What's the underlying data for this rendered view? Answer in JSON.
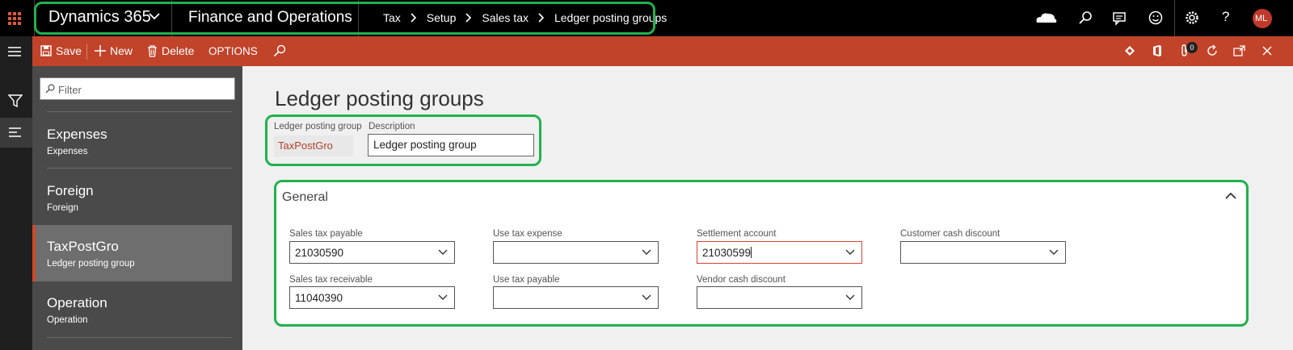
{
  "topbar": {
    "brand": "Dynamics 365",
    "app_name": "Finance and Operations",
    "breadcrumb": [
      "Tax",
      "Setup",
      "Sales tax",
      "Ledger posting groups"
    ],
    "avatar_initials": "ML"
  },
  "actions": {
    "save": "Save",
    "new": "New",
    "delete": "Delete",
    "options": "OPTIONS",
    "notification_count": "0"
  },
  "list": {
    "filter_placeholder": "Filter",
    "items": [
      {
        "title": "Expenses",
        "sub": "Expenses"
      },
      {
        "title": "Foreign",
        "sub": "Foreign"
      },
      {
        "title": "TaxPostGro",
        "sub": "Ledger posting group"
      },
      {
        "title": "Operation",
        "sub": "Operation"
      }
    ],
    "selected_index": 2
  },
  "page": {
    "title": "Ledger posting groups",
    "header_fields": {
      "group_label": "Ledger posting group",
      "group_value": "TaxPostGro",
      "description_label": "Description",
      "description_value": "Ledger posting group"
    }
  },
  "general": {
    "title": "General",
    "fields": {
      "sales_tax_payable": {
        "label": "Sales tax payable",
        "value": "21030590"
      },
      "sales_tax_receivable": {
        "label": "Sales tax receivable",
        "value": "11040390"
      },
      "use_tax_expense": {
        "label": "Use tax expense",
        "value": ""
      },
      "use_tax_payable": {
        "label": "Use tax payable",
        "value": ""
      },
      "settlement_account": {
        "label": "Settlement account",
        "value": "21030599"
      },
      "vendor_cash_discount": {
        "label": "Vendor cash discount",
        "value": ""
      },
      "customer_cash_discount": {
        "label": "Customer cash discount",
        "value": ""
      }
    }
  },
  "colors": {
    "accent": "#c1432a",
    "highlight_outline": "#22b14c",
    "nav_bg": "#000000",
    "list_bg": "#4a4a4a"
  }
}
